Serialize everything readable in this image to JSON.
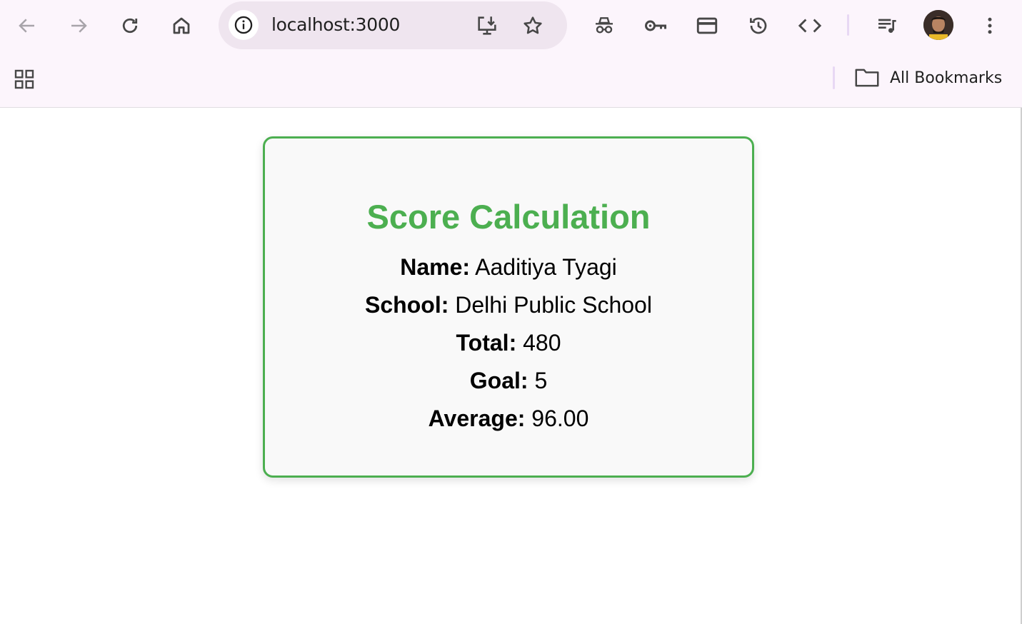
{
  "browser": {
    "url": "localhost:3000",
    "bookmarks_bar": {
      "all_bookmarks_label": "All Bookmarks"
    },
    "toolbar_icons": [
      "back-icon",
      "forward-icon",
      "reload-icon",
      "home-icon",
      "site-info-icon",
      "install-app-icon",
      "bookmark-star-icon",
      "incognito-icon",
      "password-key-icon",
      "payment-card-icon",
      "history-icon",
      "devtools-code-icon",
      "media-queue-icon",
      "profile-avatar",
      "more-menu-icon"
    ]
  },
  "card": {
    "title": "Score Calculation",
    "fields": [
      {
        "label": "Name:",
        "value": "Aaditiya Tyagi"
      },
      {
        "label": "School:",
        "value": "Delhi Public School"
      },
      {
        "label": "Total:",
        "value": "480"
      },
      {
        "label": "Goal:",
        "value": "5"
      },
      {
        "label": "Average:",
        "value": "96.00"
      }
    ]
  },
  "colors": {
    "accent_green": "#4caf50",
    "chrome_background": "#fcf5fc",
    "omnibox_background": "#efe5ef",
    "card_background": "#f9f9f9"
  }
}
